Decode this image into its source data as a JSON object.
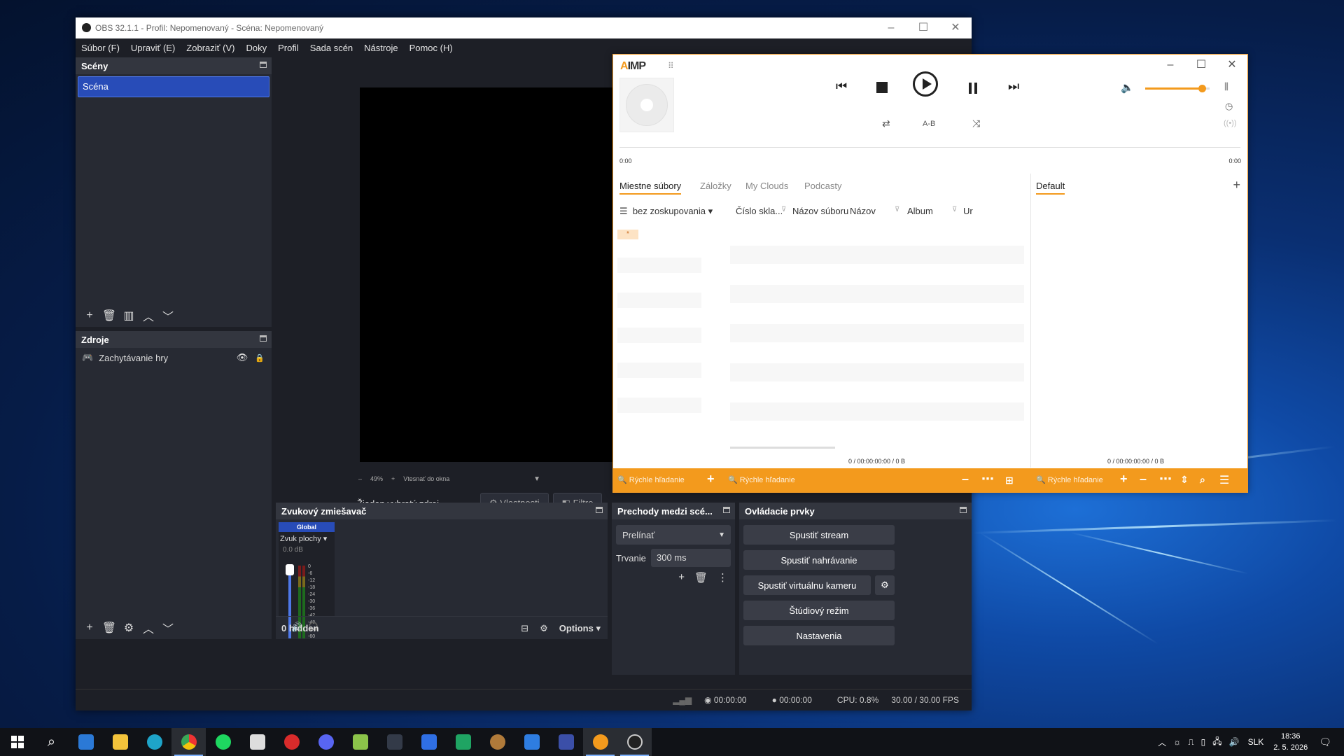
{
  "obs": {
    "title": "OBS 32.1.1 - Profil: Nepomenovaný - Scéna: Nepomenovaný",
    "menu": [
      "Súbor (F)",
      "Upraviť (E)",
      "Zobraziť (V)",
      "Doky",
      "Profil",
      "Sada scén",
      "Nástroje",
      "Pomoc (H)"
    ],
    "scenes": {
      "title": "Scény",
      "items": [
        "Scéna"
      ]
    },
    "sources": {
      "title": "Zdroje",
      "items": [
        "Zachytávanie hry"
      ]
    },
    "zoom": {
      "percent": "49%",
      "fit": "Vtesnať do okna"
    },
    "context": {
      "no_source": "Žiaden vybratý zdroj",
      "properties": "Vlastnosti",
      "filters": "Filtre"
    },
    "mixer": {
      "title": "Zvukový zmiešavač",
      "global": "Global",
      "channel": "Zvuk plochy",
      "db": "0.0 dB",
      "scale": [
        "0",
        "-6",
        "-12",
        "-18",
        "-24",
        "-30",
        "-36",
        "-42",
        "-48",
        "-54",
        "-60"
      ],
      "hidden": "0 hidden",
      "options": "Options"
    },
    "transitions": {
      "title": "Prechody medzi scé...",
      "type": "Prelínať",
      "duration_label": "Trvanie",
      "duration": "300 ms"
    },
    "controls": {
      "title": "Ovládacie prvky",
      "start_stream": "Spustiť stream",
      "start_recording": "Spustiť nahrávanie",
      "start_virtualcam": "Spustiť virtuálnu kameru",
      "studio_mode": "Štúdiový režim",
      "settings": "Nastavenia"
    },
    "status": {
      "stream_time": "00:00:00",
      "rec_time": "00:00:00",
      "cpu": "CPU: 0.8%",
      "fps": "30.00 / 30.00 FPS"
    }
  },
  "aimp": {
    "logo_a": "A",
    "logo_rest": "IMP",
    "time_start": "0:00",
    "time_end": "0:00",
    "ab": "A-B",
    "volume": 0.88,
    "tabs": [
      "Miestne súbory",
      "Záložky",
      "My Clouds",
      "Podcasty"
    ],
    "group": "bez zoskupovania",
    "columns": [
      "Číslo skla...",
      "Názov súboru",
      "Názov",
      "Album",
      "Ur"
    ],
    "group_item": "*",
    "left_stats": "0 / 00:00:00:00 / 0 B",
    "playlist": "Default",
    "right_stats": "0 / 00:00:00:00 / 0 B",
    "search_placeholder": "Rýchle hľadanie"
  },
  "tray": {
    "lang": "SLK",
    "time": "18:36",
    "date": "2. 5. 2026"
  },
  "colors": {
    "obs_bg": "#1d1f26",
    "obs_dock": "#272a33",
    "obs_select": "#284cb8",
    "aimp_accent": "#f39a1d"
  }
}
